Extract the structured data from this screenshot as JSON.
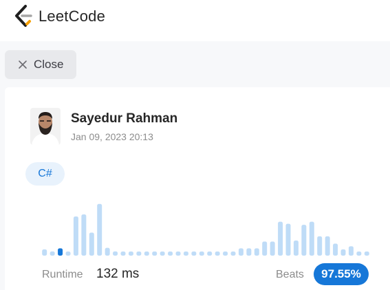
{
  "header": {
    "brand": "LeetCode",
    "logo_icon": "leetcode-logo-icon"
  },
  "toolbar": {
    "close_label": "Close",
    "close_icon": "close-icon"
  },
  "submission": {
    "user_name": "Sayedur Rahman",
    "timestamp": "Jan 09, 2023 20:13",
    "language": "C#",
    "runtime_label": "Runtime",
    "runtime_value": "132 ms",
    "beats_label": "Beats",
    "beats_value": "97.55%"
  },
  "colors": {
    "bar": "#bfdcf7",
    "bar_highlight": "#1677d8",
    "badge": "#1677d8"
  },
  "chart_data": {
    "type": "bar",
    "values": [
      0.12,
      0.08,
      0.14,
      0.07,
      0.75,
      0.79,
      0.44,
      0.99,
      0.15,
      0.08,
      0.07,
      0.07,
      0.07,
      0.07,
      0.07,
      0.07,
      0.07,
      0.07,
      0.07,
      0.07,
      0.07,
      0.07,
      0.07,
      0.07,
      0.07,
      0.14,
      0.14,
      0.14,
      0.27,
      0.27,
      0.65,
      0.61,
      0.29,
      0.59,
      0.65,
      0.37,
      0.37,
      0.23,
      0.12,
      0.18,
      0.07,
      0.07
    ],
    "highlight_index": 2,
    "ylim": [
      0,
      1
    ]
  }
}
